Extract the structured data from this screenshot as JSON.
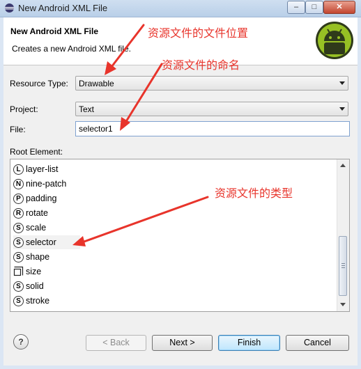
{
  "window": {
    "title": "New Android XML File",
    "min": "–",
    "max": "□",
    "close": "✕"
  },
  "header": {
    "title": "New Android XML File",
    "description": "Creates a new Android XML file.",
    "logo_icon": "android-icon"
  },
  "form": {
    "resource_type_label": "Resource Type:",
    "resource_type_value": "Drawable",
    "project_label": "Project:",
    "project_value": "Text",
    "file_label": "File:",
    "file_value": "selector1",
    "root_element_label": "Root Element:"
  },
  "root_elements": [
    {
      "icon": "L",
      "label": "layer-list"
    },
    {
      "icon": "N",
      "label": "nine-patch"
    },
    {
      "icon": "P",
      "label": "padding"
    },
    {
      "icon": "R",
      "label": "rotate"
    },
    {
      "icon": "S",
      "label": "scale"
    },
    {
      "icon": "S",
      "label": "selector",
      "selected": true
    },
    {
      "icon": "S",
      "label": "shape"
    },
    {
      "icon": "size-icon",
      "label": "size"
    },
    {
      "icon": "S",
      "label": "solid"
    },
    {
      "icon": "S",
      "label": "stroke"
    }
  ],
  "buttons": {
    "help": "?",
    "back": "< Back",
    "next": "Next >",
    "finish": "Finish",
    "cancel": "Cancel"
  },
  "annotations": {
    "location": "资源文件的文件位置",
    "naming": "资源文件的命名",
    "type": "资源文件的类型"
  },
  "colors": {
    "annotation": "#e8342b",
    "android_green": "#97c024"
  }
}
